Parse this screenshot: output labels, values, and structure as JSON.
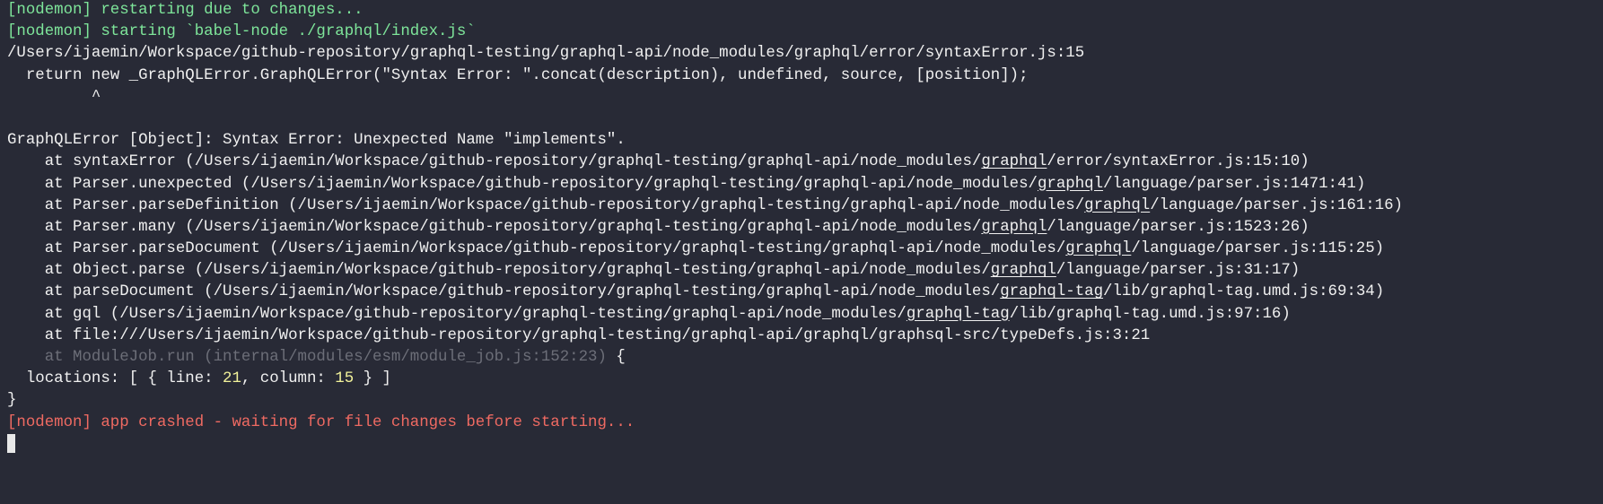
{
  "terminal": {
    "lines": [
      [
        {
          "t": "[nodemon] restarting due to changes...",
          "c": "green"
        }
      ],
      [
        {
          "t": "[nodemon] starting `babel-node ./graphql/index.js`",
          "c": "green"
        }
      ],
      [
        {
          "t": "/Users/ijaemin/Workspace/github-repository/graphql-testing/graphql-api/node_modules/graphql/error/syntaxError.js:15"
        }
      ],
      [
        {
          "t": "  return new _GraphQLError.GraphQLError(\"Syntax Error: \".concat(description), undefined, source, [position]);"
        }
      ],
      [
        {
          "t": "         ^"
        }
      ],
      [
        {
          "t": ""
        }
      ],
      [
        {
          "t": "GraphQLError [Object]: Syntax Error: Unexpected Name \"implements\"."
        }
      ],
      [
        {
          "t": "    at syntaxError (/Users/ijaemin/Workspace/github-repository/graphql-testing/graphql-api/node_modules/"
        },
        {
          "t": "graphql",
          "c": "ul"
        },
        {
          "t": "/error/syntaxError.js:15:10)"
        }
      ],
      [
        {
          "t": "    at Parser.unexpected (/Users/ijaemin/Workspace/github-repository/graphql-testing/graphql-api/node_modules/"
        },
        {
          "t": "graphql",
          "c": "ul"
        },
        {
          "t": "/language/parser.js:1471:41)"
        }
      ],
      [
        {
          "t": "    at Parser.parseDefinition (/Users/ijaemin/Workspace/github-repository/graphql-testing/graphql-api/node_modules/"
        },
        {
          "t": "graphql",
          "c": "ul"
        },
        {
          "t": "/language/parser.js:161:16)"
        }
      ],
      [
        {
          "t": "    at Parser.many (/Users/ijaemin/Workspace/github-repository/graphql-testing/graphql-api/node_modules/"
        },
        {
          "t": "graphql",
          "c": "ul"
        },
        {
          "t": "/language/parser.js:1523:26)"
        }
      ],
      [
        {
          "t": "    at Parser.parseDocument (/Users/ijaemin/Workspace/github-repository/graphql-testing/graphql-api/node_modules/"
        },
        {
          "t": "graphql",
          "c": "ul"
        },
        {
          "t": "/language/parser.js:115:25)"
        }
      ],
      [
        {
          "t": "    at Object.parse (/Users/ijaemin/Workspace/github-repository/graphql-testing/graphql-api/node_modules/"
        },
        {
          "t": "graphql",
          "c": "ul"
        },
        {
          "t": "/language/parser.js:31:17)"
        }
      ],
      [
        {
          "t": "    at parseDocument (/Users/ijaemin/Workspace/github-repository/graphql-testing/graphql-api/node_modules/"
        },
        {
          "t": "graphql-tag",
          "c": "ul"
        },
        {
          "t": "/lib/graphql-tag.umd.js:69:34)"
        }
      ],
      [
        {
          "t": "    at gql (/Users/ijaemin/Workspace/github-repository/graphql-testing/graphql-api/node_modules/"
        },
        {
          "t": "graphql-tag",
          "c": "ul"
        },
        {
          "t": "/lib/graphql-tag.umd.js:97:16)"
        }
      ],
      [
        {
          "t": "    at file:///Users/ijaemin/Workspace/github-repository/graphql-testing/graphql-api/graphql/graphsql-src/typeDefs.js:3:21"
        }
      ],
      [
        {
          "t": "    at ModuleJob.run (internal/modules/esm/module_job.js:152:23)",
          "c": "dim"
        },
        {
          "t": " {"
        }
      ],
      [
        {
          "t": "  locations: [ { line: "
        },
        {
          "t": "21",
          "c": "yellow"
        },
        {
          "t": ", column: "
        },
        {
          "t": "15",
          "c": "yellow"
        },
        {
          "t": " } ]"
        }
      ],
      [
        {
          "t": "}"
        }
      ],
      [
        {
          "t": "[nodemon] app crashed - waiting for file changes before starting...",
          "c": "red"
        }
      ]
    ]
  }
}
